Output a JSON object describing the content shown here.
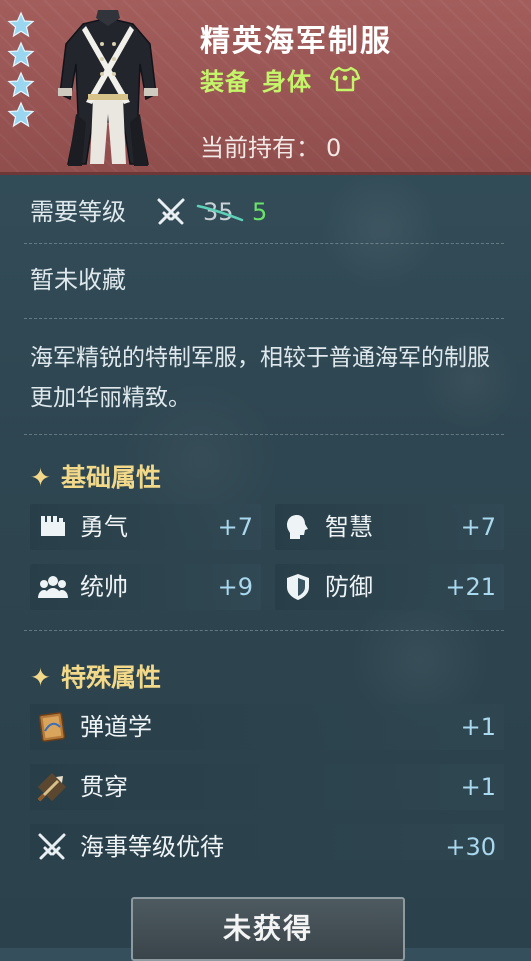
{
  "item": {
    "name": "精英海军制服",
    "category": "装备",
    "slot": "身体",
    "owned_label": "当前持有：",
    "owned_count": "0",
    "stars": 4,
    "rarity_color": "#a35e5c"
  },
  "level": {
    "label": "需要等级",
    "old_value": "35",
    "new_value": "5"
  },
  "collection_status": "暂未收藏",
  "description": "海军精锐的特制军服，相较于普通海军的制服更加华丽精致。",
  "base_attributes": {
    "title": "基础属性",
    "items": [
      {
        "name": "勇气",
        "value": "+7",
        "icon": "courage-icon"
      },
      {
        "name": "智慧",
        "value": "+7",
        "icon": "wisdom-icon"
      },
      {
        "name": "统帅",
        "value": "+9",
        "icon": "leadership-icon"
      },
      {
        "name": "防御",
        "value": "+21",
        "icon": "shield-icon"
      }
    ]
  },
  "special_attributes": {
    "title": "特殊属性",
    "items": [
      {
        "name": "弹道学",
        "value": "+1",
        "icon": "ballistics-book-icon"
      },
      {
        "name": "贯穿",
        "value": "+1",
        "icon": "penetration-icon"
      },
      {
        "name": "海事等级优待",
        "value": "+30",
        "icon": "crossed-swords-icon"
      }
    ]
  },
  "action_button": "未获得",
  "colors": {
    "accent_green": "#c4f46a",
    "section_gold": "#f2d98a",
    "value_blue": "#a9d8ef",
    "new_level_green": "#6be36b"
  }
}
